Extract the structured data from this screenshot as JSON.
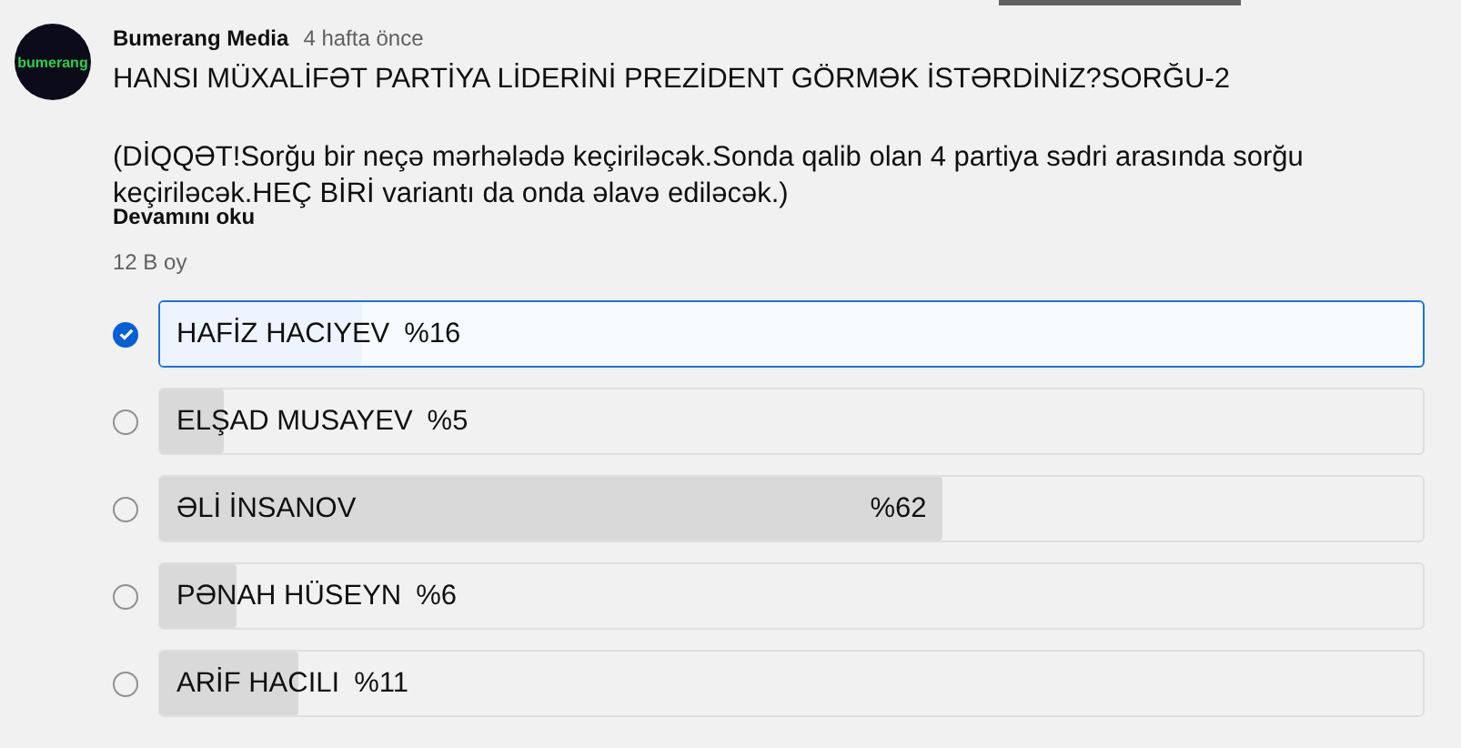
{
  "post": {
    "author": "Bumerang Media",
    "avatar_text": "bumerang",
    "time": "4 hafta önce",
    "title": "HANSI MÜXALİFƏT PARTİYA LİDERİNİ PREZİDENT GÖRMƏK İSTƏRDİNİZ?SORĞU-2",
    "body": "(DİQQƏT!Sorğu bir neçə mərhələdə keçiriləcək.Sonda qalib olan 4 partiya sədri arasında sorğu keçiriləcək.HEÇ BİRİ variantı da onda əlavə ediləcək.)",
    "read_more": "Devamını oku",
    "votes": "12 B oy"
  },
  "options": [
    {
      "label": "HAFİZ HACIYEV",
      "percent": "%16",
      "level": 0.16,
      "selected": true
    },
    {
      "label": "ELŞAD MUSAYEV",
      "percent": "%5",
      "level": 0.05,
      "selected": false
    },
    {
      "label": "ƏLİ İNSANOV",
      "percent": "%62",
      "level": 0.62,
      "selected": false
    },
    {
      "label": "PƏNAH HÜSEYN",
      "percent": "%6",
      "level": 0.06,
      "selected": false
    },
    {
      "label": "ARİF HACILI",
      "percent": "%11",
      "level": 0.11,
      "selected": false
    }
  ]
}
